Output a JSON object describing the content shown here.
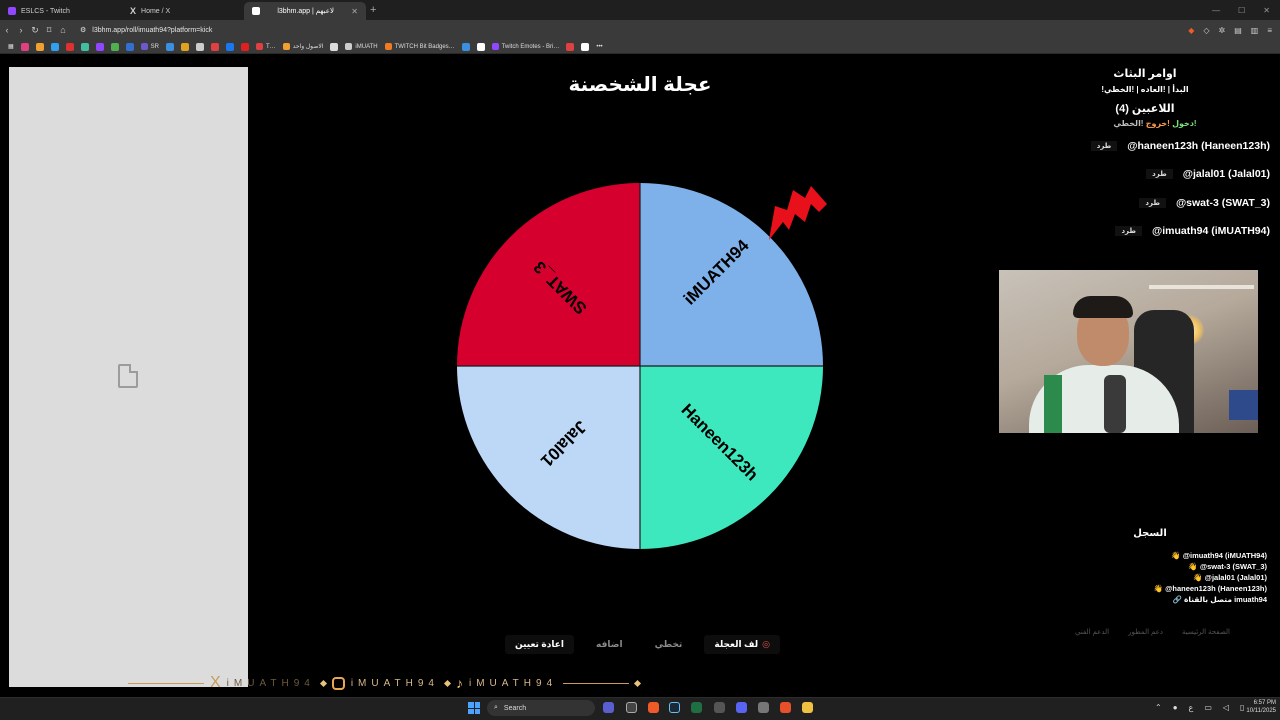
{
  "browser": {
    "tabs": [
      {
        "title": "ESLCS - Twitch",
        "color": "#9146ff"
      },
      {
        "title": "Home / X",
        "color": "#000000"
      },
      {
        "title": "l3bhm.app | لاعبهم",
        "color": "#ffffff"
      }
    ],
    "new_tab": "+",
    "url": "l3bhm.app/roll/imuath94?platform=kick",
    "bookmarks": [
      {
        "label": "SR",
        "color": "#6a5acd"
      },
      {
        "label": "T…",
        "color": "#e04040"
      },
      {
        "label": "الاصول واحد",
        "color": "#f0a030"
      },
      {
        "label": "iMUATH",
        "color": "#cccccc"
      },
      {
        "label": "TWITCH Bit Badges…",
        "color": "#f07b22"
      },
      {
        "label": "Twitch Emotes - Bri…",
        "color": "#9146ff"
      }
    ]
  },
  "wheel": {
    "title": "عجلة الشخصنة",
    "segments": [
      {
        "label": "iMUATH94",
        "color": "#7eb1ea"
      },
      {
        "label": "Haneen123h",
        "color": "#3ee8be"
      },
      {
        "label": "Jalal01",
        "color": "#bcd8f6"
      },
      {
        "label": "SWAT_3",
        "color": "#d6002f"
      }
    ],
    "pointer_color": "#e8101a"
  },
  "sidebar": {
    "title": "اوامر البثاث",
    "commands": "!البدأ | !العاده | !الخطي",
    "players_title": "اللاعبين (4)",
    "actions": {
      "join": "!دخول",
      "exit": "!خروج",
      "skip": "!الخطي"
    },
    "players": [
      {
        "name": "@haneen123h (Haneen123h)",
        "kick": "طرد"
      },
      {
        "name": "@jalal01 (Jalal01)",
        "kick": "طرد"
      },
      {
        "name": "@swat-3 (SWAT_3)",
        "kick": "طرد"
      },
      {
        "name": "@imuath94 (iMUATH94)",
        "kick": "طرد"
      }
    ]
  },
  "log": {
    "title": "السجل",
    "entries": [
      "👋 @imuath94 (iMUATH94)",
      "👋 @swat-3 (SWAT_3)",
      "👋 @jalal01 (Jalal01)",
      "👋 @haneen123h (Haneen123h)",
      "🔗 متصل بالقناة imuath94"
    ]
  },
  "footer_links": [
    "الصفحة الرئيسية",
    "دعم المطور",
    "الدعم الفني"
  ],
  "controls": {
    "spin": "لف العجلة",
    "skip": "تخطي",
    "add": "اضافه",
    "reset": "اعادة تعيين"
  },
  "banner": {
    "segments": [
      "iMUATH94",
      "iMUATH94",
      "iMUATH94",
      "iMUATH94"
    ]
  },
  "taskbar": {
    "search": "Search",
    "time": "6:57 PM",
    "date": "10/11/2025",
    "lang": "ع"
  }
}
